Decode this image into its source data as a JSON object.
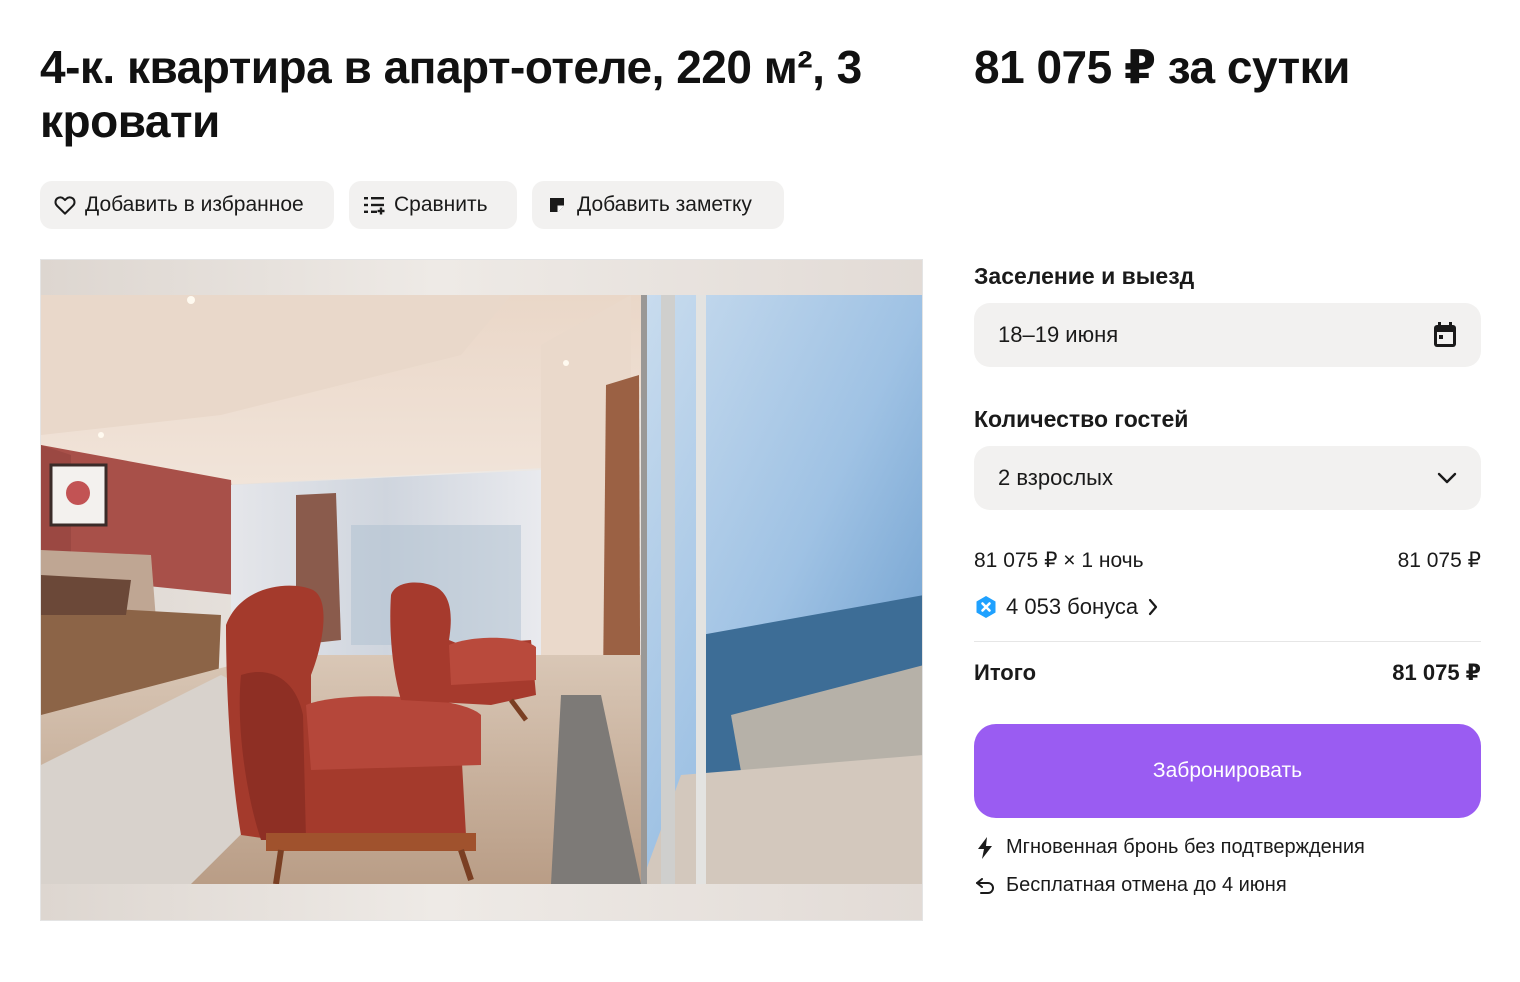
{
  "listing": {
    "title": "4-к. квартира в апарт-отеле, 220 м², 3 кровати",
    "price_title": "81 075 ₽ за сутки"
  },
  "actions": {
    "favorite_label": "Добавить в избранное",
    "compare_label": "Сравнить",
    "note_label": "Добавить заметку"
  },
  "booking": {
    "dates_label": "Заселение и выезд",
    "dates_value": "18–19 июня",
    "guests_label": "Количество гостей",
    "guests_value": "2 взрослых",
    "price_line_label": "81 075 ₽ × 1 ночь",
    "price_line_value": "81 075 ₽",
    "bonus_text": "4 053 бонуса",
    "total_label": "Итого",
    "total_value": "81 075 ₽",
    "book_button": "Забронировать",
    "instant_note": "Мгновенная бронь без подтверждения",
    "cancel_note": "Бесплатная отмена до 4 июня"
  },
  "colors": {
    "accent": "#9a5cf2",
    "button_bg": "#f2f1f0",
    "bonus_icon": "#1fa1ff"
  },
  "icons": {
    "favorite": "heart-icon",
    "compare": "compare-list-icon",
    "note": "note-icon",
    "calendar": "calendar-icon",
    "dropdown": "chevron-down-icon",
    "bonus": "bonus-badge-icon",
    "bonus_arrow": "chevron-right-icon",
    "instant": "lightning-icon",
    "cancel": "return-arrow-icon"
  }
}
